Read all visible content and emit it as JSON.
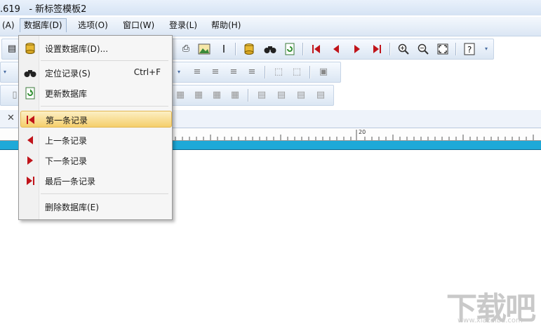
{
  "window": {
    "title": ".619   - 新标签模板2"
  },
  "menubar": {
    "items": [
      "(A)",
      "数据库(D)",
      "选项(O)",
      "窗口(W)",
      "登录(L)",
      "帮助(H)"
    ]
  },
  "tab": {
    "close": "✕"
  },
  "ruler": {
    "label": "20"
  },
  "dropdown": {
    "items": [
      {
        "label": "设置数据库(D)...",
        "icon": "database-icon"
      },
      {
        "label": "定位记录(S)",
        "shortcut": "Ctrl+F",
        "icon": "binoculars-icon"
      },
      {
        "label": "更新数据库",
        "icon": "refresh-database-icon"
      },
      {
        "label": "第一条记录",
        "icon": "first-record-icon"
      },
      {
        "label": "上一条记录",
        "icon": "previous-record-icon"
      },
      {
        "label": "下一条记录",
        "icon": "next-record-icon"
      },
      {
        "label": "最后一条记录",
        "icon": "last-record-icon"
      },
      {
        "label": "删除数据库(E)"
      }
    ]
  },
  "colors": {
    "accent": "#1ea9d8",
    "highlight": "#f5cf6c",
    "nav_red": "#c0141a"
  },
  "watermark": {
    "logo_text": "下载吧",
    "site": "www.xiazaiba.com"
  }
}
